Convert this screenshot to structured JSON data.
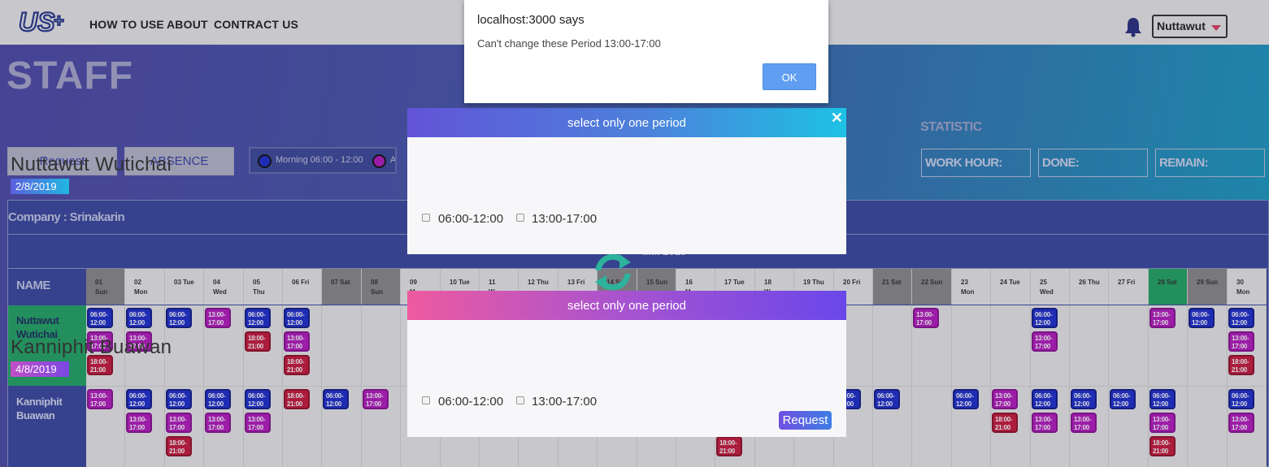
{
  "nav": {
    "links": [
      "HOW TO USE",
      "ABOUT",
      "CONTRACT US"
    ],
    "user": "Nuttawut"
  },
  "page": {
    "title": "STAFF",
    "request_button": "Request",
    "absence_button": "ABSENCE",
    "legend": {
      "morning": "Morning 06:00 - 12:00",
      "afternoon": "Afte"
    },
    "statistic": {
      "title": "STATISTIC",
      "work_hour": "WORK HOUR:",
      "done": "DONE:",
      "remain": "REMAIN:"
    }
  },
  "table": {
    "company": "Company : Srinakarin",
    "name_header": "NAME",
    "month_label": "...... 2019",
    "days": [
      [
        "01",
        "Sun"
      ],
      [
        "02",
        "Mon"
      ],
      [
        "03 Tue",
        ""
      ],
      [
        "04",
        "Wed"
      ],
      [
        "05",
        "Thu"
      ],
      [
        "06 Fri",
        ""
      ],
      [
        "07 Sat",
        ""
      ],
      [
        "08",
        "Sun"
      ],
      [
        "09",
        "M"
      ],
      [
        "10 Tue",
        ""
      ],
      [
        "11",
        "W"
      ],
      [
        "12 Thu",
        ""
      ],
      [
        "13 Fri",
        ""
      ],
      [
        "14 Sat",
        ""
      ],
      [
        "15 Sun",
        ""
      ],
      [
        "16",
        "M"
      ],
      [
        "17 Tue",
        ""
      ],
      [
        "18",
        "W"
      ],
      [
        "19 Thu",
        ""
      ],
      [
        "20 Fri",
        ""
      ],
      [
        "21 Sat",
        ""
      ],
      [
        "22 Sun",
        ""
      ],
      [
        "23",
        "Mon"
      ],
      [
        "24 Tue",
        ""
      ],
      [
        "25",
        "Wed"
      ],
      [
        "26 Thu",
        ""
      ],
      [
        "27 Fri",
        ""
      ],
      [
        "28 Sat",
        ""
      ],
      [
        "29 Sun",
        ""
      ],
      [
        "30",
        "Mon"
      ]
    ],
    "staff": [
      {
        "name": "Nuttawut Wutichai"
      },
      {
        "name": "Kanniphit Buawan"
      }
    ],
    "shift_labels": {
      "morning": "06:00-12:00",
      "afternoon": "13:00-17:00",
      "evening": "18:00-21:00"
    }
  },
  "modal1": {
    "header": "select only one period",
    "close": "✕",
    "name": "Nuttawut Wutichai",
    "date": "2/8/2019",
    "option1": "06:00-12:00",
    "option2": "13:00-17:00"
  },
  "modal2": {
    "header": "select only one period",
    "name": "Kanniphit Buawan",
    "date": "4/8/2019",
    "option1": "06:00-12:00",
    "option2": "13:00-17:00",
    "button": "Request"
  },
  "alert": {
    "title": "localhost:3000 says",
    "message": "Can't change these Period 13:00-17:00",
    "ok": "OK"
  },
  "colors": {
    "morning": "#1e2fcf",
    "afternoon": "#b61cbf",
    "evening": "#c81a3d",
    "today": "#21a765"
  }
}
